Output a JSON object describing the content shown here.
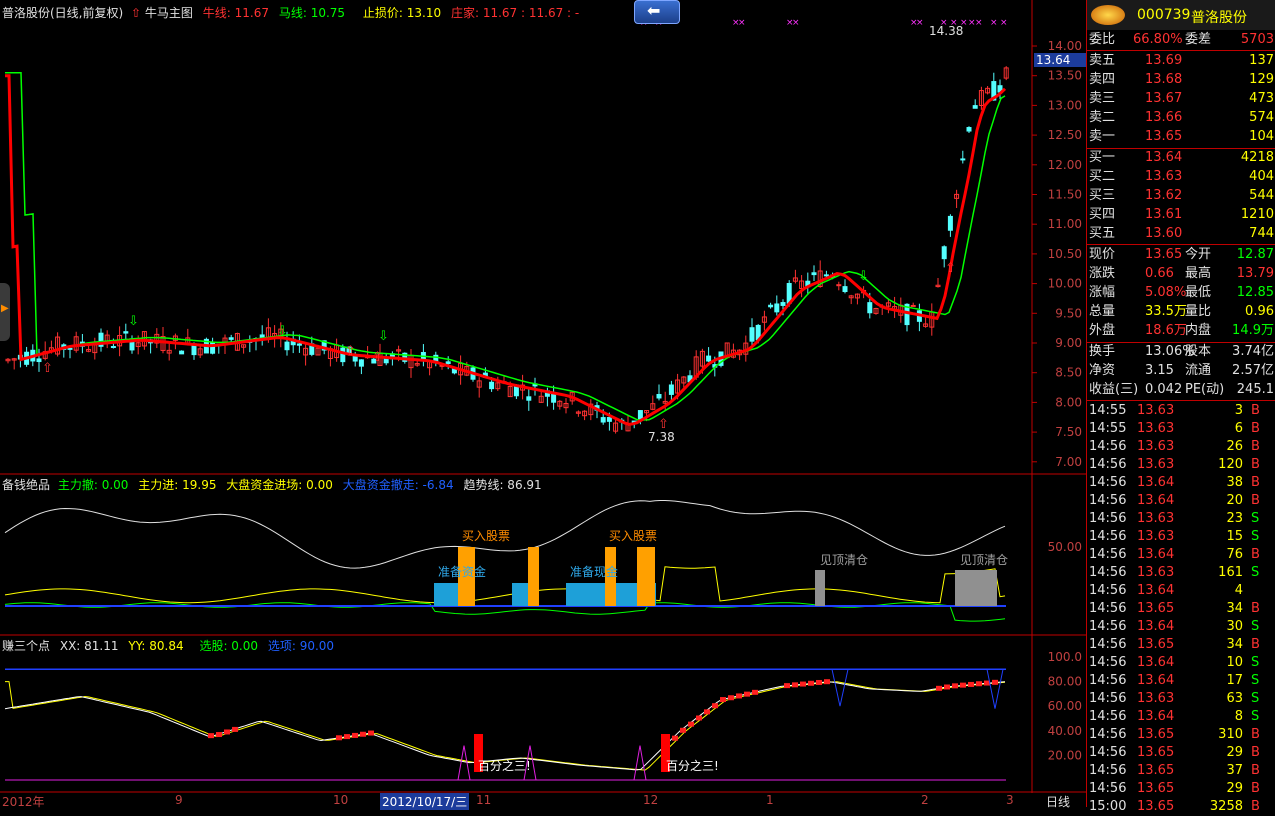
{
  "header": {
    "stock_title": "普洛股份(日线,前复权)",
    "indicator_name": "牛马主图",
    "niu_label": "牛线:",
    "niu_value": "11.67",
    "ma_label": "马线:",
    "ma_value": "10.75",
    "stoploss_label": "止损价:",
    "stoploss_value": "13.10",
    "zhuangjia_label": "庄家:",
    "zhuangjia_value": "11.67",
    "zhuangjia_extra": ": 11.67 : -"
  },
  "main_chart": {
    "y_ticks": [
      "14.00",
      "13.50",
      "13.00",
      "12.50",
      "12.00",
      "11.50",
      "11.00",
      "10.50",
      "10.00",
      "9.50",
      "9.00",
      "8.50",
      "8.00",
      "7.50",
      "7.00"
    ],
    "current_price_tag": "13.64",
    "high_label": "14.38",
    "low_label": "7.38",
    "colors": {
      "up": "#ff3232",
      "down": "#54ffff",
      "niu": "#ff0000",
      "ma": "#00ff00"
    }
  },
  "sub1": {
    "name": "备钱绝品",
    "l1": "主力撤: 0.00",
    "l2": "主力进: 19.95",
    "l3": "大盘资金进场: 0.00",
    "l4": "大盘资金撤走: -6.84",
    "l5": "趋势线: 86.91",
    "y_tick": "50.00",
    "buy1": "买入股票",
    "buy2": "买入股票",
    "prep1": "准备资金",
    "prep2": "准备现金",
    "top1": "见顶清仓",
    "top2": "见顶清仓"
  },
  "sub2": {
    "name": "赚三个点",
    "xx": "XX: 81.11",
    "yy": "YY: 80.84",
    "xuangu": "选股: 0.00",
    "xuanxiang": "选项: 90.00",
    "y_ticks": [
      "100.0",
      "80.00",
      "60.00",
      "40.00",
      "20.00"
    ],
    "mark1": "百分之三!",
    "mark2": "百分之三!"
  },
  "x_axis": {
    "labels": [
      "2012年",
      "9",
      "10",
      "2012/10/17/三",
      "11",
      "12",
      "1",
      "2",
      "3"
    ],
    "period": "日线"
  },
  "panel": {
    "code": "000739",
    "name": "普洛股份",
    "weibi_label": "委比",
    "weibi_value": "66.80%",
    "weicha_label": "委差",
    "weicha_value": "5703",
    "asks": [
      {
        "label": "卖五",
        "price": "13.69",
        "vol": "137"
      },
      {
        "label": "卖四",
        "price": "13.68",
        "vol": "129"
      },
      {
        "label": "卖三",
        "price": "13.67",
        "vol": "473"
      },
      {
        "label": "卖二",
        "price": "13.66",
        "vol": "574"
      },
      {
        "label": "卖一",
        "price": "13.65",
        "vol": "104"
      }
    ],
    "bids": [
      {
        "label": "买一",
        "price": "13.64",
        "vol": "4218"
      },
      {
        "label": "买二",
        "price": "13.63",
        "vol": "404"
      },
      {
        "label": "买三",
        "price": "13.62",
        "vol": "544"
      },
      {
        "label": "买四",
        "price": "13.61",
        "vol": "1210"
      },
      {
        "label": "买五",
        "price": "13.60",
        "vol": "744"
      }
    ],
    "quote": [
      {
        "l1": "现价",
        "v1": "13.65",
        "l2": "今开",
        "v2": "12.87"
      },
      {
        "l1": "涨跌",
        "v1": "0.66",
        "l2": "最高",
        "v2": "13.79"
      },
      {
        "l1": "涨幅",
        "v1": "5.08%",
        "l2": "最低",
        "v2": "12.85"
      },
      {
        "l1": "总量",
        "v1": "33.5万",
        "l2": "量比",
        "v2": "0.96"
      },
      {
        "l1": "外盘",
        "v1": "18.6万",
        "l2": "内盘",
        "v2": "14.9万"
      }
    ],
    "fund": [
      {
        "l1": "换手",
        "v1": "13.06%",
        "l2": "股本",
        "v2": "3.74亿"
      },
      {
        "l1": "净资",
        "v1": "3.15",
        "l2": "流通",
        "v2": "2.57亿"
      },
      {
        "l1": "收益(三)",
        "v1": "0.042",
        "l2": "PE(动)",
        "v2": "245.1"
      }
    ],
    "ticks": [
      {
        "t": "14:55",
        "p": "13.63",
        "v": "3",
        "d": "B"
      },
      {
        "t": "14:55",
        "p": "13.63",
        "v": "6",
        "d": "B"
      },
      {
        "t": "14:56",
        "p": "13.63",
        "v": "26",
        "d": "B"
      },
      {
        "t": "14:56",
        "p": "13.63",
        "v": "120",
        "d": "B"
      },
      {
        "t": "14:56",
        "p": "13.64",
        "v": "38",
        "d": "B"
      },
      {
        "t": "14:56",
        "p": "13.64",
        "v": "20",
        "d": "B"
      },
      {
        "t": "14:56",
        "p": "13.63",
        "v": "23",
        "d": "S"
      },
      {
        "t": "14:56",
        "p": "13.63",
        "v": "15",
        "d": "S"
      },
      {
        "t": "14:56",
        "p": "13.64",
        "v": "76",
        "d": "B"
      },
      {
        "t": "14:56",
        "p": "13.63",
        "v": "161",
        "d": "S"
      },
      {
        "t": "14:56",
        "p": "13.64",
        "v": "4",
        "d": ""
      },
      {
        "t": "14:56",
        "p": "13.65",
        "v": "34",
        "d": "B"
      },
      {
        "t": "14:56",
        "p": "13.64",
        "v": "30",
        "d": "S"
      },
      {
        "t": "14:56",
        "p": "13.65",
        "v": "34",
        "d": "B"
      },
      {
        "t": "14:56",
        "p": "13.64",
        "v": "10",
        "d": "S"
      },
      {
        "t": "14:56",
        "p": "13.64",
        "v": "17",
        "d": "S"
      },
      {
        "t": "14:56",
        "p": "13.63",
        "v": "63",
        "d": "S"
      },
      {
        "t": "14:56",
        "p": "13.64",
        "v": "8",
        "d": "S"
      },
      {
        "t": "14:56",
        "p": "13.65",
        "v": "310",
        "d": "B"
      },
      {
        "t": "14:56",
        "p": "13.65",
        "v": "29",
        "d": "B"
      },
      {
        "t": "14:56",
        "p": "13.65",
        "v": "37",
        "d": "B"
      },
      {
        "t": "14:56",
        "p": "13.65",
        "v": "29",
        "d": "B"
      },
      {
        "t": "15:00",
        "p": "13.65",
        "v": "3258",
        "d": "B"
      }
    ]
  }
}
